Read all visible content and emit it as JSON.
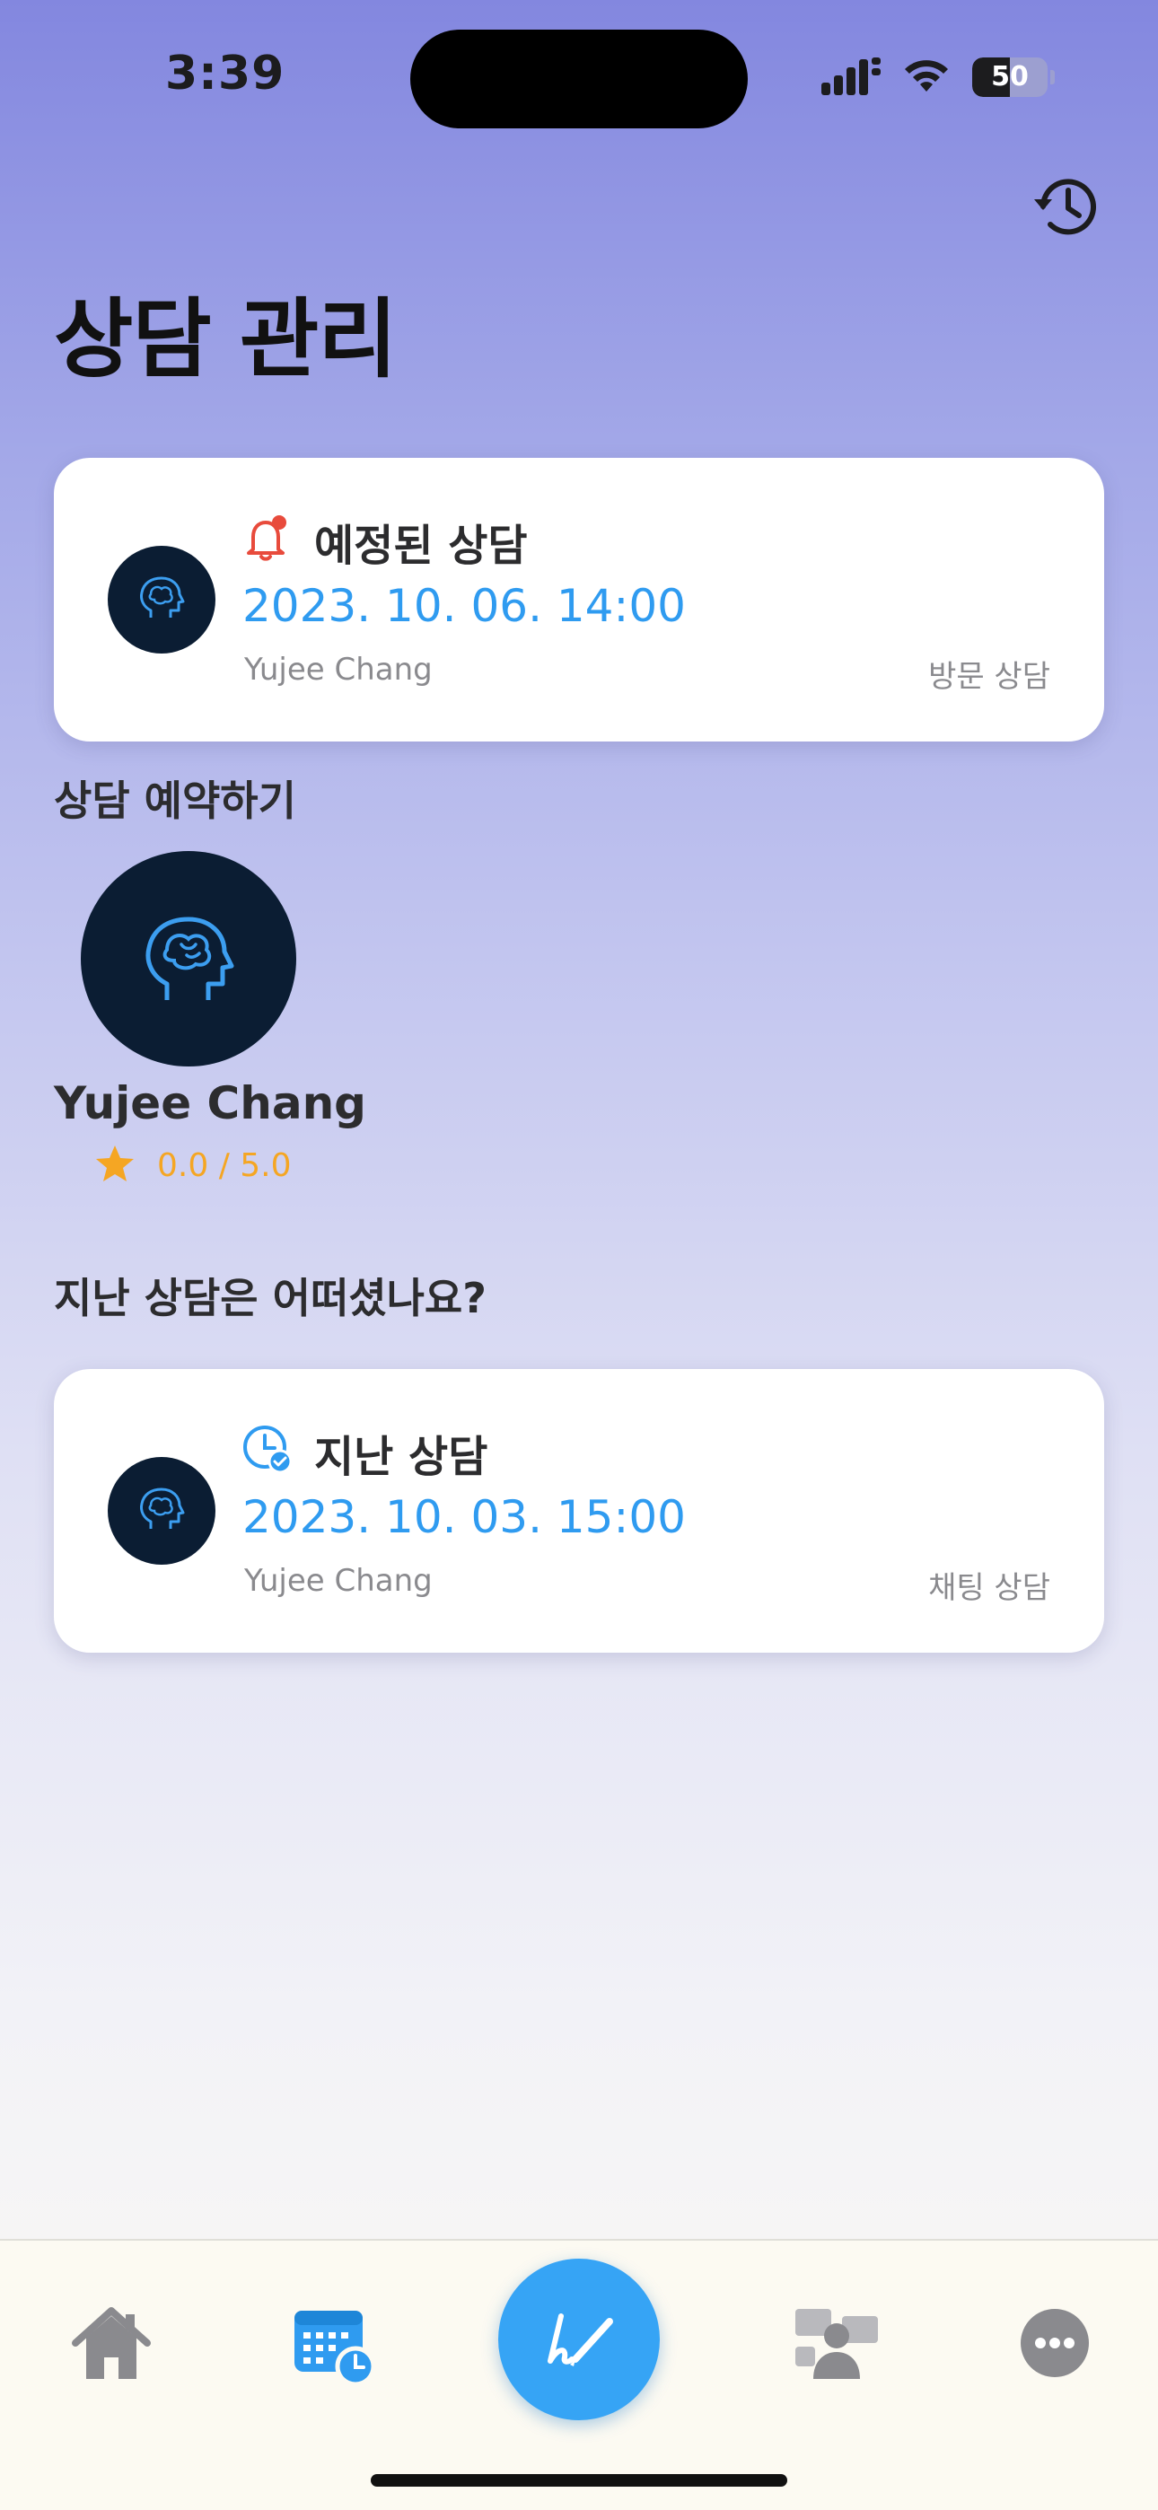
{
  "status_bar": {
    "time": "3:39",
    "battery": "50",
    "battery_level": 0.5
  },
  "header": {
    "title": "상담 관리",
    "history_icon": "history-icon"
  },
  "upcoming": {
    "heading": "예정된 상담",
    "datetime": "2023. 10. 06. 14:00",
    "counselor": "Yujee Chang",
    "type": "방문 상담",
    "icon": "bell-icon"
  },
  "reserve": {
    "section_title": "상담 예약하기",
    "counselor_name": "Yujee Chang",
    "rating": "0.0 / 5.0"
  },
  "past_section": {
    "title": "지난 상담은 어떠셨나요?"
  },
  "past": {
    "heading": "지난 상담",
    "datetime": "2023. 10. 03. 15:00",
    "counselor": "Yujee Chang",
    "type": "채팅 상담",
    "icon": "clock-check-icon"
  },
  "tab_bar": {
    "tabs": [
      "home-icon",
      "calendar-icon",
      "write-icon",
      "people-icon",
      "more-icon"
    ]
  },
  "colors": {
    "accent": "#36a4f5",
    "avatar_bg": "#0b1d33",
    "alert": "#e84b3c",
    "star": "#f5a623"
  }
}
